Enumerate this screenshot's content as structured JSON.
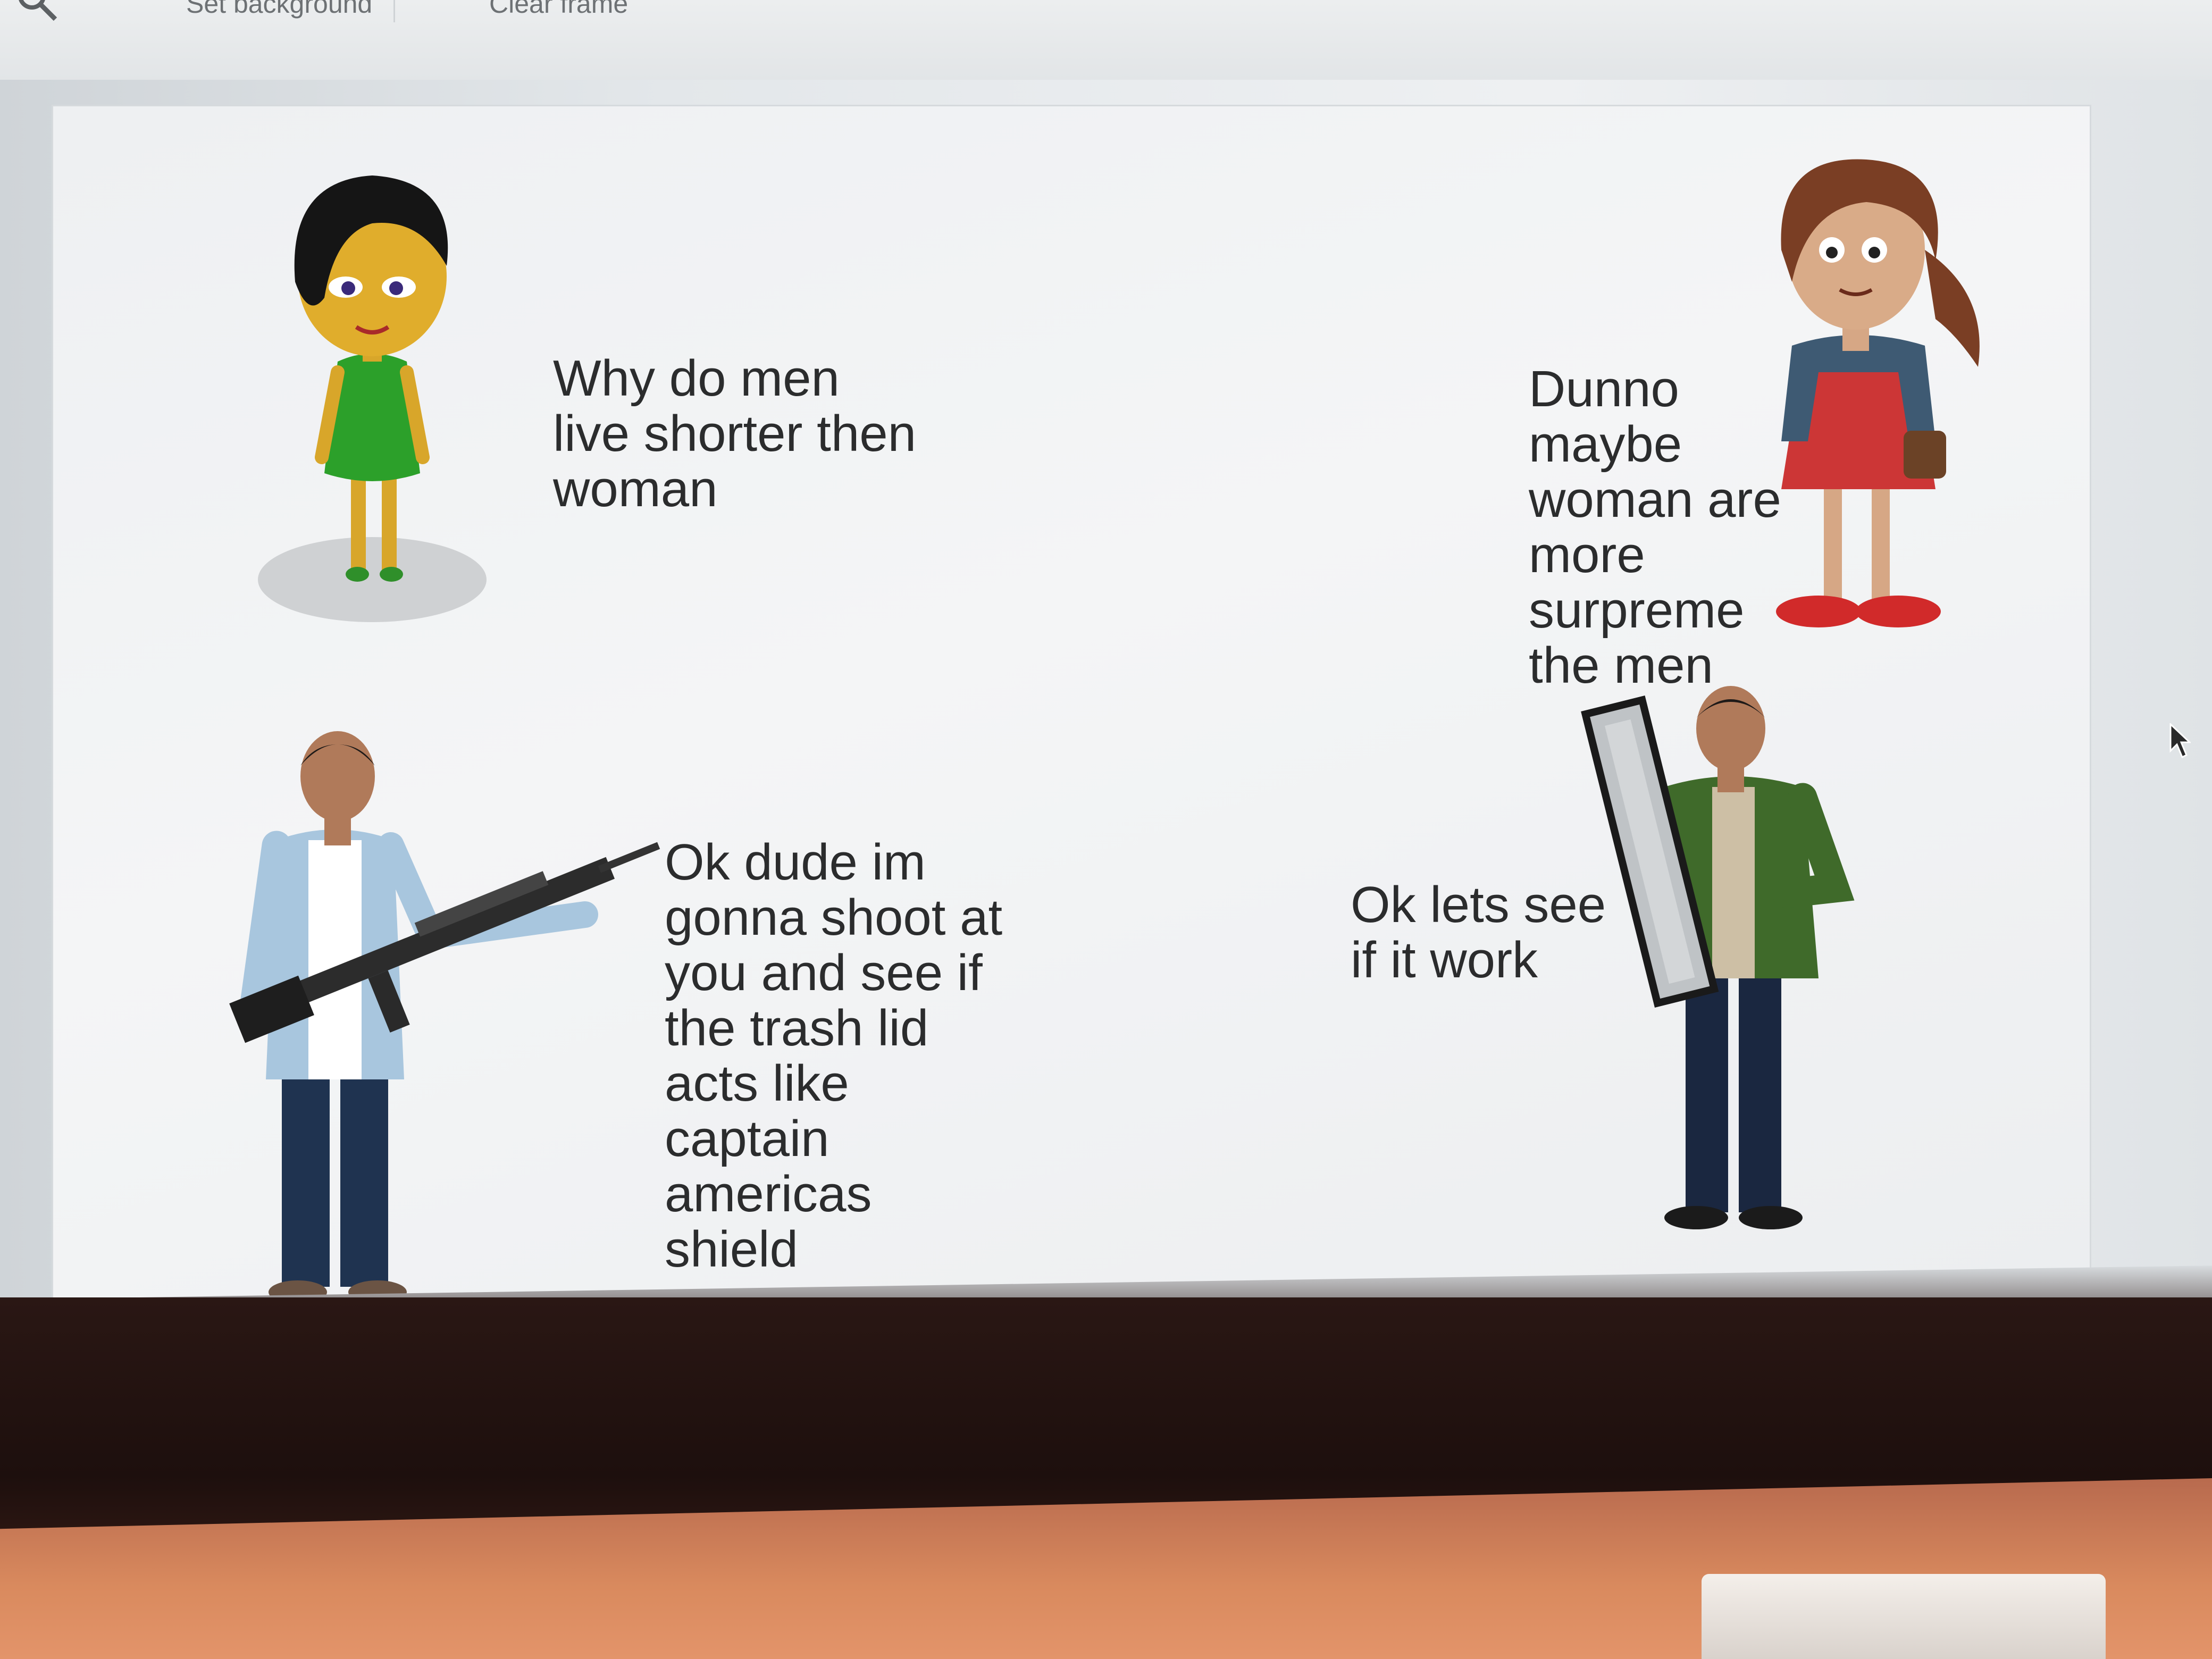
{
  "toolbar": {
    "set_background_label": "Set background",
    "clear_frame_label": "Clear frame",
    "icons": [
      "search-icon"
    ]
  },
  "scene": {
    "dialogues": [
      "Why do men live shorter then woman",
      "Dunno maybe woman are more surpreme the men",
      "Ok dude im gonna shoot at you and see if the trash lid acts like captain americas shield",
      "Ok lets see if it work"
    ],
    "characters": [
      "woman-green-dress",
      "girl-red-dress",
      "man-with-rifle",
      "man-with-shield"
    ]
  },
  "colors": {
    "canvas": "#f2f3f4",
    "text": "#2b2c2d",
    "laptop_body": "#d98a5e"
  }
}
